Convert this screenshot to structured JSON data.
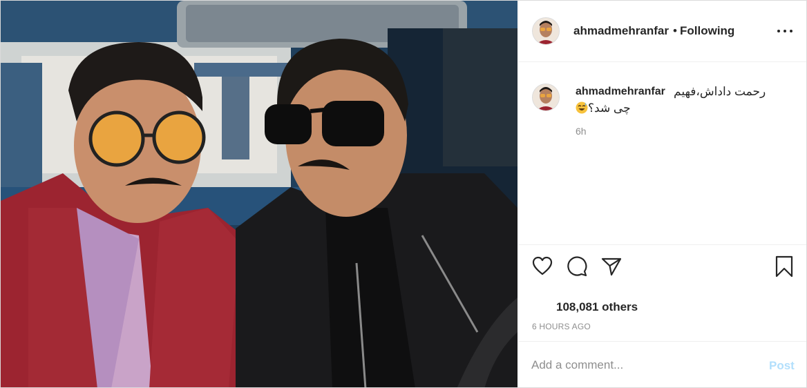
{
  "post": {
    "photo_icon": "post-photo",
    "username": "ahmadmehranfar",
    "separator": "•",
    "follow_status": "Following",
    "more_icon": "more-options-icon",
    "caption": {
      "username": "ahmadmehranfar",
      "line1": "رحمت داداش،فهیم",
      "line2": "چی شد؟",
      "emoji": "sweat-smile-emoji",
      "time": "6h"
    },
    "actions": {
      "like_icon": "heart-icon",
      "comment_icon": "comment-icon",
      "share_icon": "share-icon",
      "save_icon": "bookmark-icon"
    },
    "likes_text": "108,081 others",
    "posted_ago": "6 HOURS AGO",
    "comment": {
      "placeholder": "Add a comment...",
      "post_label": "Post",
      "post_color": "#b2dffc"
    }
  }
}
